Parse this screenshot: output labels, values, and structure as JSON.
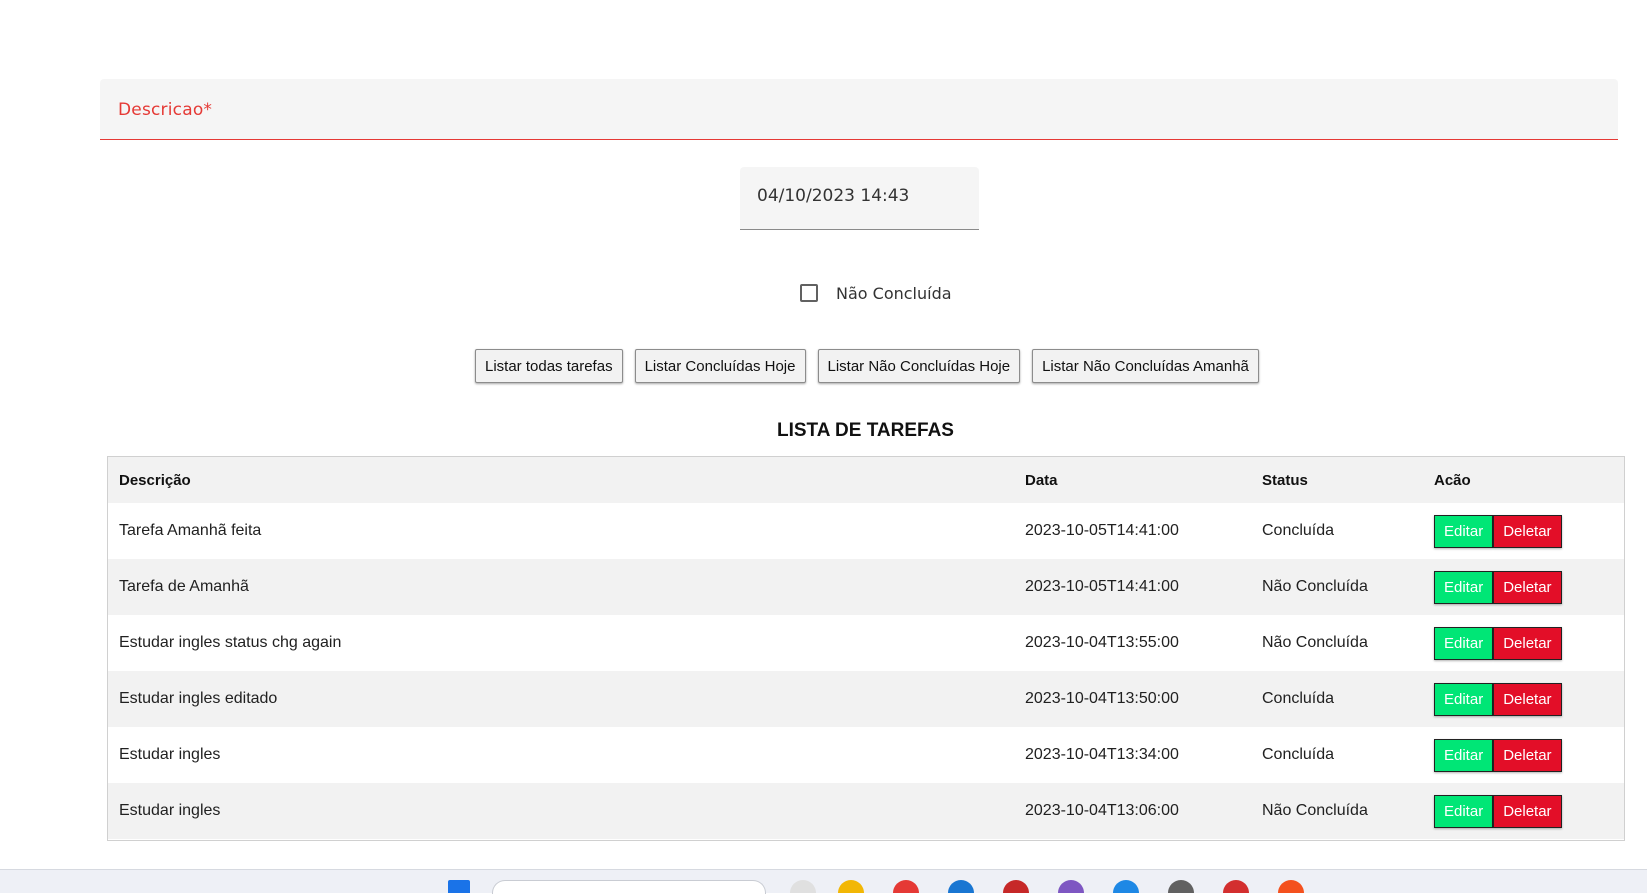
{
  "form": {
    "description_label": "Descricao*",
    "date_value": "04/10/2023 14:43",
    "checkbox_label": "Não Concluída"
  },
  "buttons": [
    "Listar todas tarefas",
    "Listar Concluídas Hoje",
    "Listar Não Concluídas Hoje",
    "Listar Não Concluídas Amanhã"
  ],
  "list": {
    "title": "LISTA DE TAREFAS",
    "headers": [
      "Descrição",
      "Data",
      "Status",
      "Acão"
    ],
    "rows": [
      {
        "descricao": "Tarefa Amanhã feita",
        "data": "2023-10-05T14:41:00",
        "status": "Concluída"
      },
      {
        "descricao": "Tarefa de Amanhã",
        "data": "2023-10-05T14:41:00",
        "status": "Não Concluída"
      },
      {
        "descricao": "Estudar ingles status chg again",
        "data": "2023-10-04T13:55:00",
        "status": "Não Concluída"
      },
      {
        "descricao": "Estudar ingles editado",
        "data": "2023-10-04T13:50:00",
        "status": "Concluída"
      },
      {
        "descricao": "Estudar ingles",
        "data": "2023-10-04T13:34:00",
        "status": "Concluída"
      },
      {
        "descricao": "Estudar ingles",
        "data": "2023-10-04T13:06:00",
        "status": "Não Concluída"
      }
    ],
    "edit_label": "Editar",
    "delete_label": "Deletar"
  },
  "colors": {
    "error": "#e53935",
    "edit": "#00e676",
    "delete": "#e30e28"
  }
}
